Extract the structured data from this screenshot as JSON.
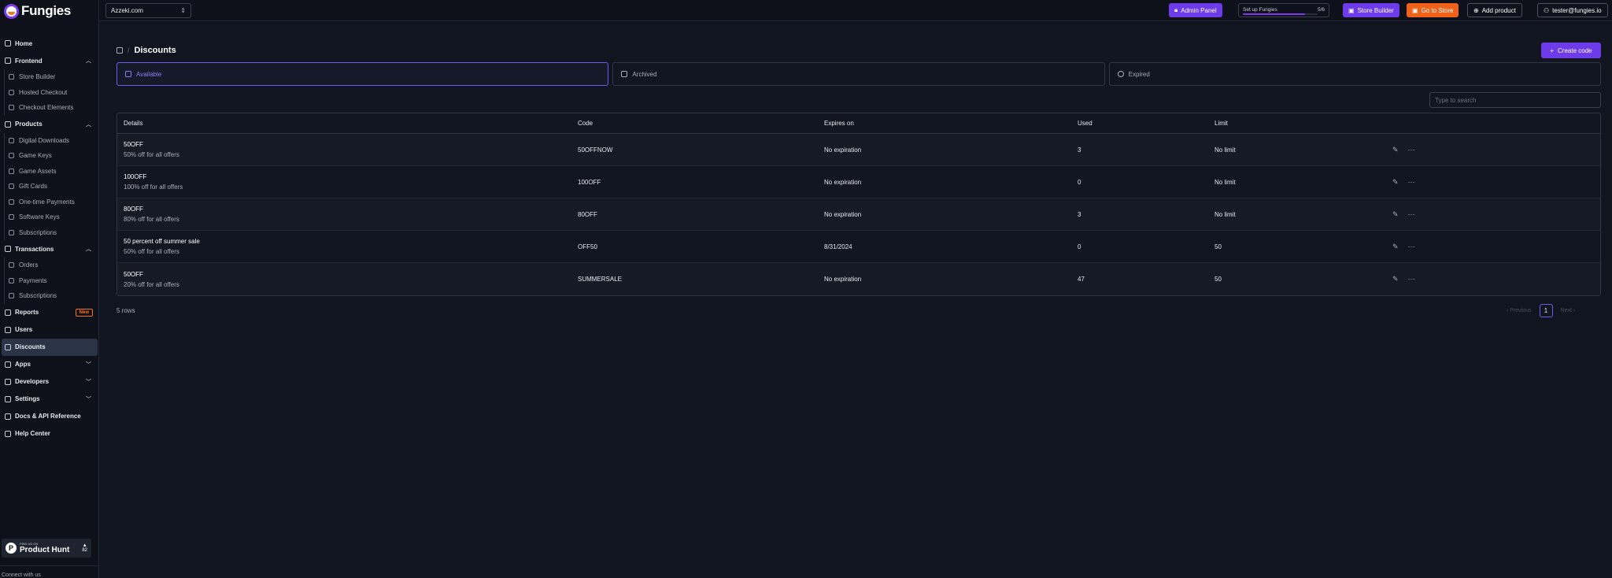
{
  "brand": {
    "name": "Fungies"
  },
  "topbar": {
    "store": "Azzeki.com",
    "admin_panel": "Admin Panel",
    "setup_label": "Set up Fungies",
    "setup_count": "5/6",
    "setup_progress": 0.83,
    "store_builder": "Store Builder",
    "go_to_store": "Go to Store",
    "add_product": "Add product",
    "user": "tester@fungies.io"
  },
  "sidebar": {
    "home": "Home",
    "frontend": "Frontend",
    "frontend_items": [
      "Store Builder",
      "Hosted Checkout",
      "Checkout Elements"
    ],
    "products": "Products",
    "products_items": [
      "Digital Downloads",
      "Game Keys",
      "Game Assets",
      "Gift Cards",
      "One-time Payments",
      "Software Keys",
      "Subscriptions"
    ],
    "transactions": "Transactions",
    "transactions_items": [
      "Orders",
      "Payments",
      "Subscriptions"
    ],
    "reports": "Reports",
    "reports_badge": "New",
    "users": "Users",
    "discounts": "Discounts",
    "apps": "Apps",
    "developers": "Developers",
    "settings": "Settings",
    "docs": "Docs & API Reference",
    "help": "Help Center",
    "ph_small": "FIND US ON",
    "ph_big": "Product Hunt",
    "ph_votes": "82",
    "connect": "Connect with us"
  },
  "page": {
    "title": "Discounts",
    "create_button": "Create code",
    "tabs": [
      "Available",
      "Archived",
      "Expired"
    ],
    "search_placeholder": "Type to search",
    "columns": [
      "Details",
      "Code",
      "Expires on",
      "Used",
      "Limit"
    ],
    "rows": [
      {
        "name": "50OFF",
        "desc": "50% off for all offers",
        "code": "50OFFNOW",
        "expires": "No expiration",
        "used": "3",
        "limit": "No limit"
      },
      {
        "name": "100OFF",
        "desc": "100% off for all offers",
        "code": "100OFF",
        "expires": "No expiration",
        "used": "0",
        "limit": "No limit"
      },
      {
        "name": "80OFF",
        "desc": "80% off for all offers",
        "code": "80OFF",
        "expires": "No expiration",
        "used": "3",
        "limit": "No limit"
      },
      {
        "name": "50 percent off summer sale",
        "desc": "50% off for all offers",
        "code": "OFF50",
        "expires": "8/31/2024",
        "used": "0",
        "limit": "50"
      },
      {
        "name": "50OFF",
        "desc": "20% off for all offers",
        "code": "SUMMERSALE",
        "expires": "No expiration",
        "used": "47",
        "limit": "50"
      }
    ],
    "rows_count": "5 rows",
    "prev": "Previous",
    "page": "1",
    "next": "Next"
  }
}
